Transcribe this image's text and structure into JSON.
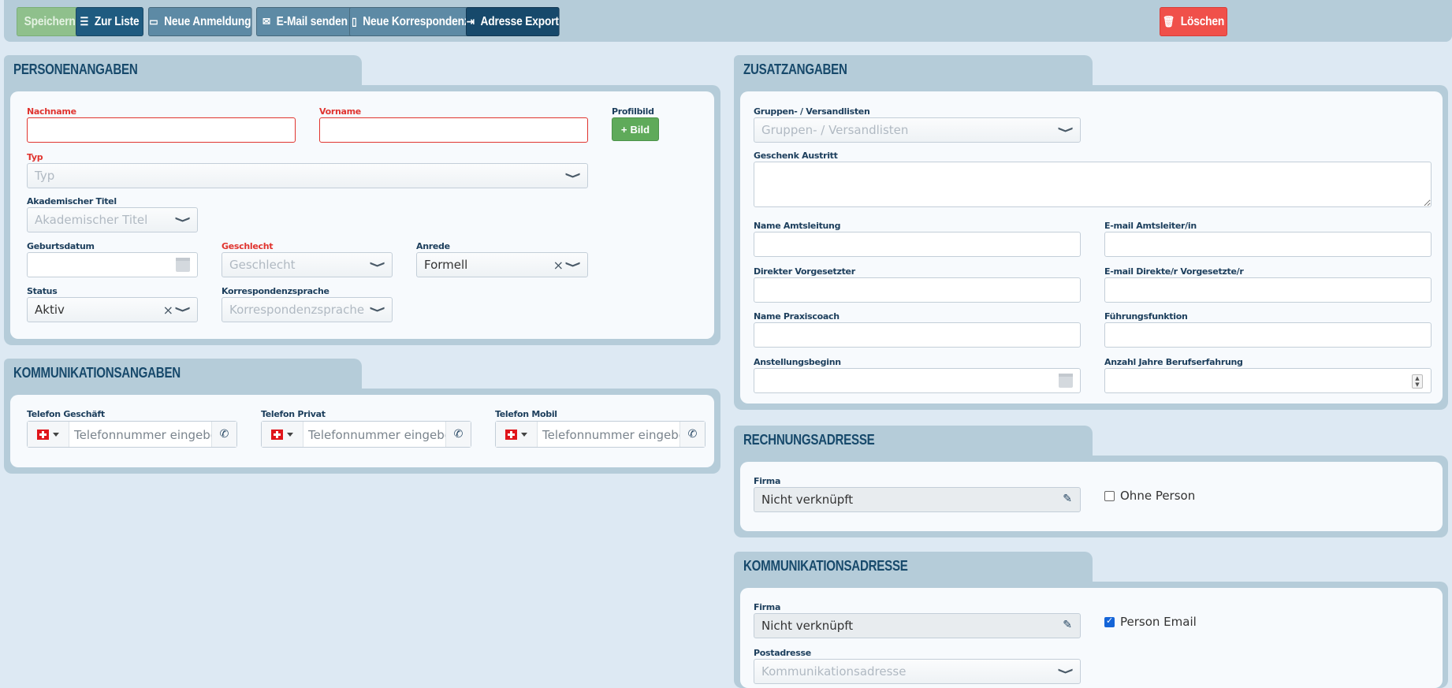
{
  "toolbar": {
    "save": "Speichern",
    "list": "Zur Liste",
    "new_registration": "Neue Anmeldung",
    "send_email": "E-Mail senden",
    "new_correspondence": "Neue Korrespondenz",
    "export_address": "Adresse Export",
    "delete": "Löschen"
  },
  "personal": {
    "title": "PERSONENANGABEN",
    "lastname_label": "Nachname",
    "firstname_label": "Vorname",
    "profile_label": "Profilbild",
    "profile_button": "Bild",
    "type_label": "Typ",
    "type_placeholder": "Typ",
    "academic_label": "Akademischer Titel",
    "academic_placeholder": "Akademischer Titel",
    "birthdate_label": "Geburtsdatum",
    "gender_label": "Geschlecht",
    "gender_placeholder": "Geschlecht",
    "salutation_label": "Anrede",
    "salutation_value": "Formell",
    "status_label": "Status",
    "status_value": "Aktiv",
    "language_label": "Korrespondenzsprache",
    "language_placeholder": "Korrespondenzsprache"
  },
  "communication": {
    "title": "KOMMUNIKATIONSANGABEN",
    "phones": [
      {
        "label": "Telefon Geschäft",
        "placeholder": "Telefonnummer eingeben"
      },
      {
        "label": "Telefon Privat",
        "placeholder": "Telefonnummer eingeben"
      },
      {
        "label": "Telefon Mobil",
        "placeholder": "Telefonnummer eingeben"
      }
    ]
  },
  "additional": {
    "title": "ZUSATZANGABEN",
    "groups_label": "Gruppen- / Versandlisten",
    "groups_placeholder": "Gruppen- / Versandlisten",
    "gift_label": "Geschenk Austritt",
    "head_name_label": "Name Amtsleitung",
    "head_email_label": "E-mail Amtsleiter/in",
    "supervisor_label": "Direkter Vorgesetzter",
    "supervisor_email_label": "E-mail Direkte/r Vorgesetzte/r",
    "coach_label": "Name Praxiscoach",
    "leadership_label": "Führungsfunktion",
    "start_label": "Anstellungsbeginn",
    "experience_label": "Anzahl Jahre Berufserfahrung"
  },
  "billing": {
    "title": "RECHNUNGSADRESSE",
    "company_label": "Firma",
    "company_value": "Nicht verknüpft",
    "without_person": "Ohne Person",
    "without_person_checked": false
  },
  "comm_address": {
    "title": "KOMMUNIKATIONSADRESSE",
    "company_label": "Firma",
    "company_value": "Nicht verknüpft",
    "person_email": "Person Email",
    "person_email_checked": true,
    "postal_label": "Postadresse",
    "postal_placeholder": "Kommunikationsadresse"
  }
}
